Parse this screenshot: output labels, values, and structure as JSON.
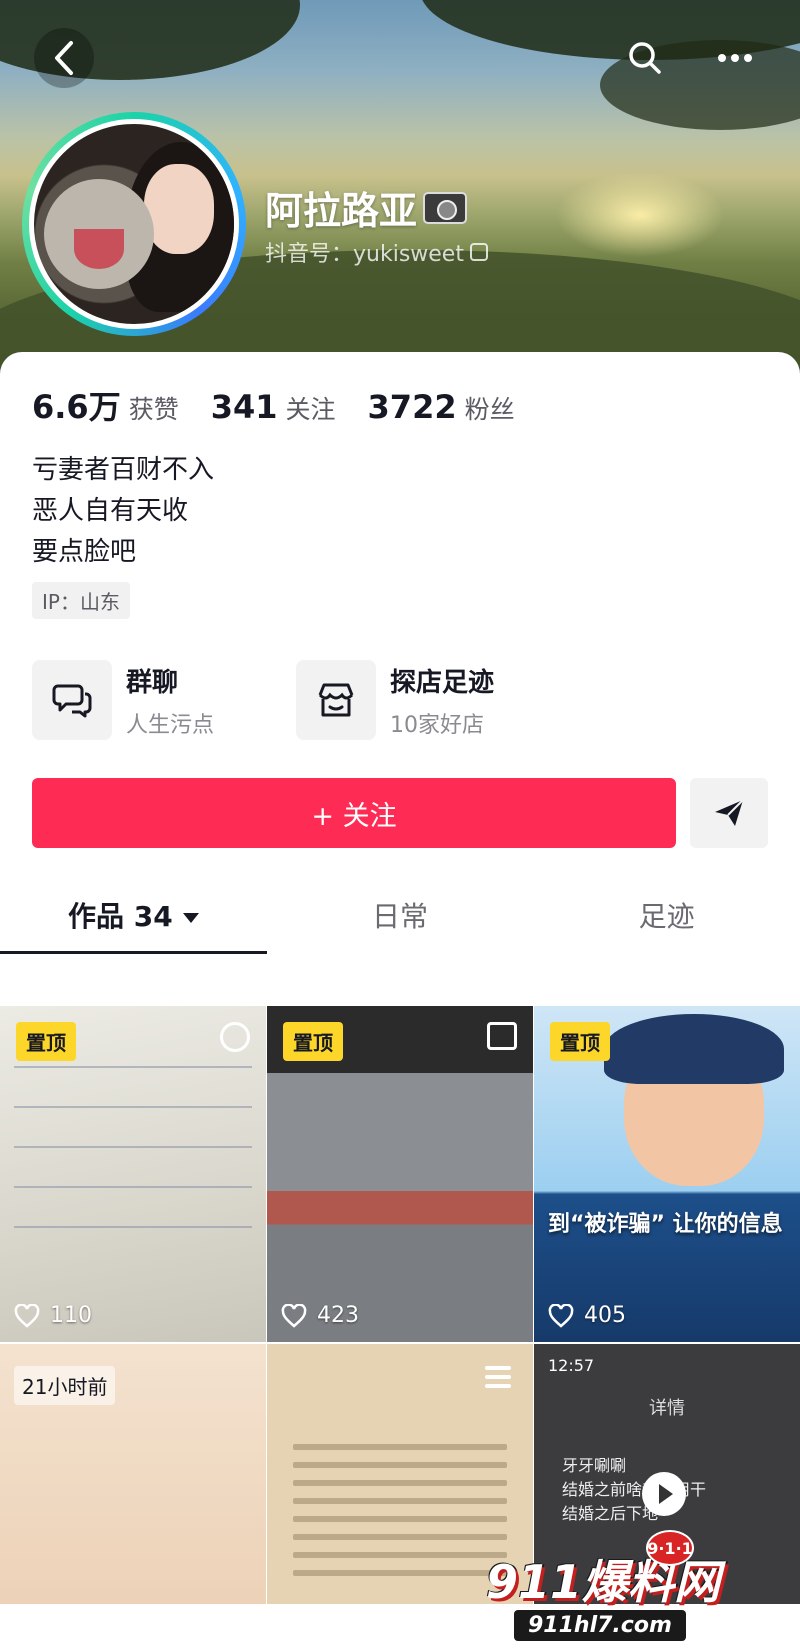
{
  "header": {
    "nickname": "阿拉路亚",
    "douyin_id": "抖音号：yukisweet"
  },
  "stats": [
    {
      "value": "6.6万",
      "label": "获赞"
    },
    {
      "value": "341",
      "label": "关注"
    },
    {
      "value": "3722",
      "label": "粉丝"
    }
  ],
  "bio": [
    "亏妻者百财不入",
    "恶人自有天收",
    "要点脸吧"
  ],
  "ip": "IP：山东",
  "features": {
    "group_chat": {
      "title": "群聊",
      "subtitle": "人生污点"
    },
    "shop_visit": {
      "title": "探店足迹",
      "subtitle": "10家好店"
    }
  },
  "actions": {
    "follow_label": "+ 关注"
  },
  "tabs": [
    {
      "label": "作品 34"
    },
    {
      "label": "日常"
    },
    {
      "label": "足迹"
    }
  ],
  "videos": [
    {
      "pinned_label": "置顶",
      "likes": "110"
    },
    {
      "pinned_label": "置顶",
      "likes": "423"
    },
    {
      "pinned_label": "置顶",
      "likes": "405",
      "overlay": "到“被诈骗” 让你的信息"
    },
    {
      "time_label": "21小时前"
    },
    {},
    {
      "status_time": "12:57",
      "title": "详情",
      "messages": [
        "牙牙唰唰",
        "结婚之前啥都不用干",
        "结婚之后下地"
      ]
    }
  ],
  "watermark": {
    "brand": "911爆料网",
    "badge": "9·1·1",
    "url": "911hl7.com"
  },
  "colors": {
    "accent": "#fe2c55",
    "pin_badge": "#fdd62a"
  }
}
